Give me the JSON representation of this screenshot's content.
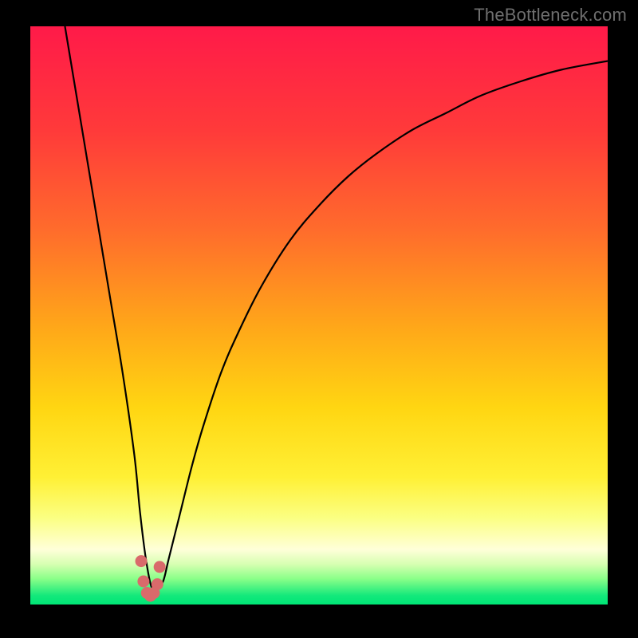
{
  "watermark": "TheBottleneck.com",
  "colors": {
    "frame": "#000000",
    "curve": "#000000",
    "dots": "#d96a6b",
    "gradient_stops": [
      {
        "offset": 0.0,
        "color": "#ff1a49"
      },
      {
        "offset": 0.18,
        "color": "#ff3a3a"
      },
      {
        "offset": 0.35,
        "color": "#ff6b2c"
      },
      {
        "offset": 0.52,
        "color": "#ffa719"
      },
      {
        "offset": 0.66,
        "color": "#ffd612"
      },
      {
        "offset": 0.78,
        "color": "#fff035"
      },
      {
        "offset": 0.85,
        "color": "#fbff82"
      },
      {
        "offset": 0.905,
        "color": "#ffffd9"
      },
      {
        "offset": 0.93,
        "color": "#d7ffb2"
      },
      {
        "offset": 0.955,
        "color": "#8cff89"
      },
      {
        "offset": 0.985,
        "color": "#12e87b"
      },
      {
        "offset": 1.0,
        "color": "#00e676"
      }
    ]
  },
  "chart_data": {
    "type": "line",
    "title": "",
    "xlabel": "",
    "ylabel": "",
    "xlim": [
      0,
      100
    ],
    "ylim": [
      0,
      100
    ],
    "grid": false,
    "legend": false,
    "series": [
      {
        "name": "bottleneck-curve",
        "x": [
          6,
          8,
          10,
          12,
          14,
          16,
          18,
          19,
          20,
          21,
          22,
          23,
          24,
          26,
          28,
          30,
          33,
          36,
          40,
          45,
          50,
          55,
          60,
          66,
          72,
          78,
          85,
          92,
          100
        ],
        "y": [
          100,
          88,
          76,
          64,
          52,
          40,
          26,
          16,
          8,
          3,
          3,
          4,
          8,
          16,
          24,
          31,
          40,
          47,
          55,
          63,
          69,
          74,
          78,
          82,
          85,
          88,
          90.5,
          92.5,
          94
        ]
      }
    ],
    "highlight_points": {
      "name": "valley-dots",
      "x": [
        19.2,
        19.6,
        20.2,
        20.8,
        21.4,
        22.0,
        22.4
      ],
      "y": [
        7.5,
        4.0,
        2.0,
        1.5,
        2.0,
        3.5,
        6.5
      ]
    }
  }
}
